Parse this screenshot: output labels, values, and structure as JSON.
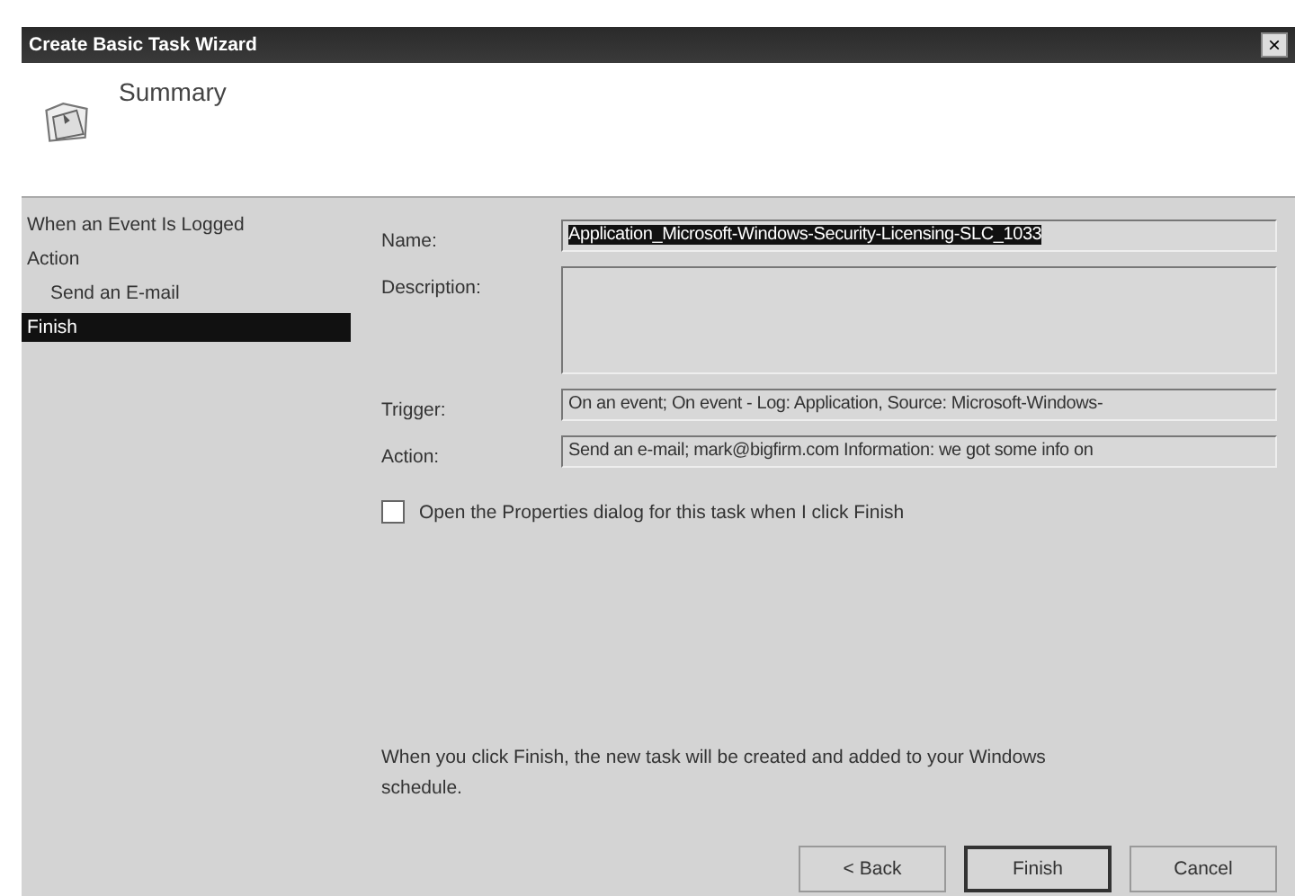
{
  "window": {
    "title": "Create Basic Task Wizard",
    "close": "×"
  },
  "header": {
    "title": "Summary"
  },
  "steps": [
    {
      "label": "When an Event Is Logged",
      "selected": false
    },
    {
      "label": "Action",
      "selected": false,
      "children": [
        {
          "label": "Send an E-mail",
          "selected": false
        }
      ]
    },
    {
      "label": "Finish",
      "selected": true
    }
  ],
  "fields": [
    {
      "label": "Name:",
      "kind": "line",
      "value": "Application_Microsoft-Windows-Security-Licensing-SLC_1033",
      "text_selected": true
    },
    {
      "label": "Description:",
      "kind": "area"
    },
    {
      "label": "Trigger:",
      "kind": "line",
      "value": "On an event; On event - Log: Application, Source: Microsoft-Windows-",
      "text_selected": false
    },
    {
      "label": "Action:",
      "kind": "line",
      "value": "Send an e-mail; mark@bigfirm.com Information:  we got some info on",
      "text_selected": false
    }
  ],
  "open_properties": {
    "label": "Open the Properties dialog for this task when I click Finish",
    "checked": false
  },
  "note": "When you click Finish, the new task will be created and added to your Windows schedule.",
  "buttons": [
    {
      "label": "< Back",
      "default": false
    },
    {
      "label": "Finish",
      "default": true
    },
    {
      "label": "Cancel",
      "default": false
    }
  ]
}
